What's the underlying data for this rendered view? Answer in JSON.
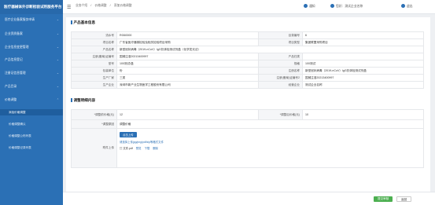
{
  "app": {
    "title": "医疗器械体外诊断检验试剂服务平台"
  },
  "sidebar": {
    "items": [
      {
        "label": "医疗企业备案服务申请",
        "expanded": false
      },
      {
        "label": "企业资质备案",
        "expanded": false
      },
      {
        "label": "企业信息变更管理",
        "expanded": false
      },
      {
        "label": "产品信息登记",
        "expanded": false
      },
      {
        "label": "注册证信息管理",
        "expanded": false
      },
      {
        "label": "产品目录",
        "expanded": false
      },
      {
        "label": "价格调整",
        "expanded": true
      }
    ],
    "sub_items": [
      {
        "label": "添加价格调整",
        "active": true
      },
      {
        "label": "价格调整确认",
        "active": false
      },
      {
        "label": "价格调整公布列表",
        "active": false
      },
      {
        "label": "价格调整记录列表",
        "active": false
      }
    ]
  },
  "topbar": {
    "crumbs": [
      "业务介绍",
      "价格调整",
      "添加价格调整"
    ],
    "notice_label": "通知",
    "user_label": "您好：测试企业名称",
    "logout_label": "退出"
  },
  "sections": {
    "product_info": "产品基本信息",
    "adjust_info": "调整明细内容"
  },
  "product_fields": [
    {
      "label": "流水号",
      "value": "RG60000"
    },
    {
      "label": "目录编号",
      "value": "6"
    },
    {
      "label": "项目名称",
      "value": "广东省医疗器械检验及相关检验项目采购"
    },
    {
      "label": "项目类型",
      "value": "集团联盟采购项目"
    },
    {
      "label": "产品名称",
      "value": "新型冠状病毒（2019-nCoV）IgG抗体检测试剂盒（化学发光法）"
    },
    {
      "label": "注册(备案)证编号",
      "value": "国械注准20213400997"
    },
    {
      "label": "产品归类",
      "value": ""
    },
    {
      "label": "型号",
      "value": "100测试/盒"
    },
    {
      "label": "规格",
      "value": "100测试"
    },
    {
      "label": "包装单位",
      "value": "份"
    },
    {
      "label": "注册名称",
      "value": "新型冠状病毒（2019-nCoV）IgG抗体检测试剂盒"
    },
    {
      "label": "生产厂家",
      "value": "三类"
    },
    {
      "label": "注册(备案)证编号2",
      "value": "国械注准20213400997"
    },
    {
      "label": "生产企业",
      "value": "深圳市新产业生物医学工程股份有限公司"
    },
    {
      "label": "经营企业",
      "value": "测试企业名称"
    }
  ],
  "adjust_fields": {
    "orig_price_label": "*调整前价格(元)",
    "orig_price_value": "12",
    "new_price_label": "*调整后价格(元)",
    "new_price_value": "10",
    "reason_label": "*调整原因",
    "reason_value": "调整价格",
    "attach_label": "附件上传",
    "upload_button": "点击上传",
    "upload_hint": "请选择上传jpg/png/pdf/zip等格式文件",
    "file_name": "文件.pdf",
    "file_links": [
      "预览",
      "下载",
      "删除"
    ]
  },
  "footer": {
    "submit_label": "提交审核",
    "back_label": "返回"
  }
}
